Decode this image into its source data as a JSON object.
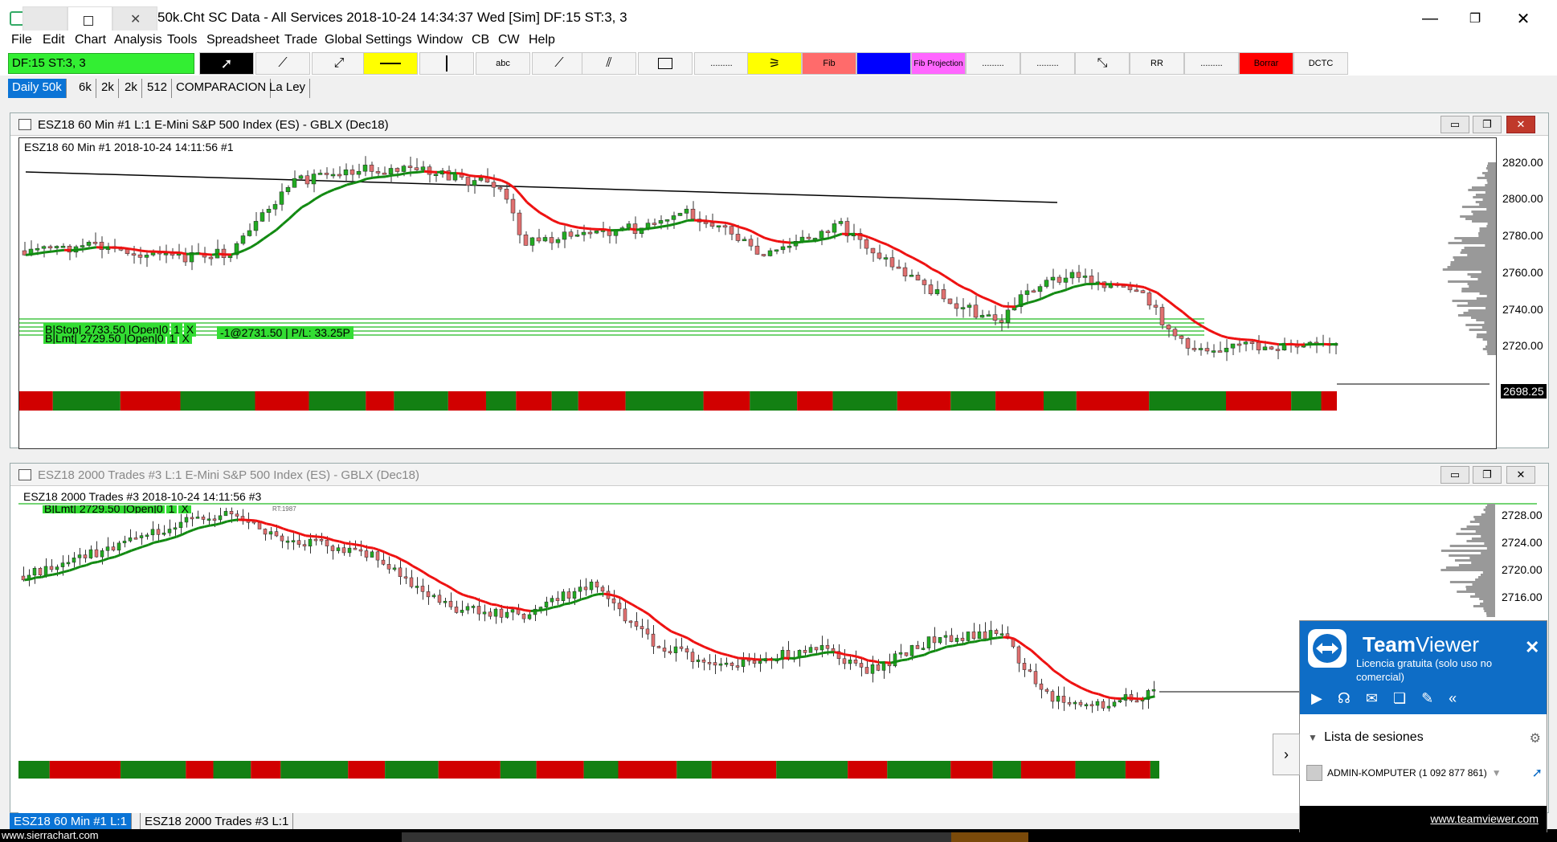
{
  "window": {
    "title": "50k.Cht  SC Data - All Services 2018-10-24  14:34:37 Wed [Sim]  DF:15  ST:3, 3"
  },
  "menu": [
    "File",
    "Edit",
    "Chart",
    "Analysis",
    "Tools",
    "Spreadsheet",
    "Trade",
    "Global Settings",
    "Window",
    "CB",
    "CW",
    "Help"
  ],
  "toolbar": {
    "df_box": "DF:15  ST:3, 3",
    "abc": "abc",
    "dots": ".........",
    "fib": "Fib",
    "fib2": "Fib",
    "fib_projection": "Fib Projection",
    "rr": "RR",
    "borrar": "Borrar",
    "dctc": "DCTC",
    "colors": {
      "yellow": "#ffff00",
      "pink": "#ff6b6b",
      "blue": "#0000ff",
      "magenta": "#ff66ff",
      "red": "#ff0000"
    }
  },
  "chartbook_tabs": [
    "Daily  50k",
    "6k",
    "2k",
    "2k",
    "512",
    "COMPARACION",
    "La Ley"
  ],
  "chart1": {
    "header": "ESZ18  60 Min   #1  L:1  E-Mini S&P 500 Index (ES) - GBLX (Dec18)",
    "info": "ESZ18  60 Min   #1 2018-10-24 14:11:56 #1",
    "price_labels": [
      "2820.00",
      "2800.00",
      "2780.00",
      "2760.00",
      "2740.00",
      "2720.00"
    ],
    "last_price": "2698.25",
    "order1": "B|Stop| 2733.50 |Open|0",
    "order1_qty": "1",
    "order1_x": "X",
    "order2": "B|Lmt| 2729.50 |Open|0",
    "order2_qty": "1",
    "order2_x": "X",
    "position": "-1@2731.50 | P/L: 33.25P"
  },
  "chart2": {
    "header": "ESZ18  2000 Trades  #3  L:1  E-Mini S&P 500 Index (ES) - GBLX (Dec18)",
    "info": "ESZ18  2000 Trades  #3 2018-10-24 14:11:56 #3",
    "order": "B|Lmt| 2729.50 |Open|0",
    "order_qty": "1",
    "order_x": "X",
    "rt": "RT:1987",
    "price_labels": [
      "2728.00",
      "2724.00",
      "2720.00",
      "2716.00"
    ]
  },
  "bottom_tabs": [
    "ESZ18  60 Min   #1   L:1",
    "ESZ18  2000 Trades  #3  L:1"
  ],
  "status": {
    "site": "www.sierrachart.com"
  },
  "teamviewer": {
    "brand_a": "Team",
    "brand_b": "Viewer",
    "subtitle": "Licencia gratuita (solo uso no comercial)",
    "sessions_label": "Lista de sesiones",
    "session_item": "ADMIN-KOMPUTER (1 092 877 861)",
    "link": "www.teamviewer.com"
  }
}
